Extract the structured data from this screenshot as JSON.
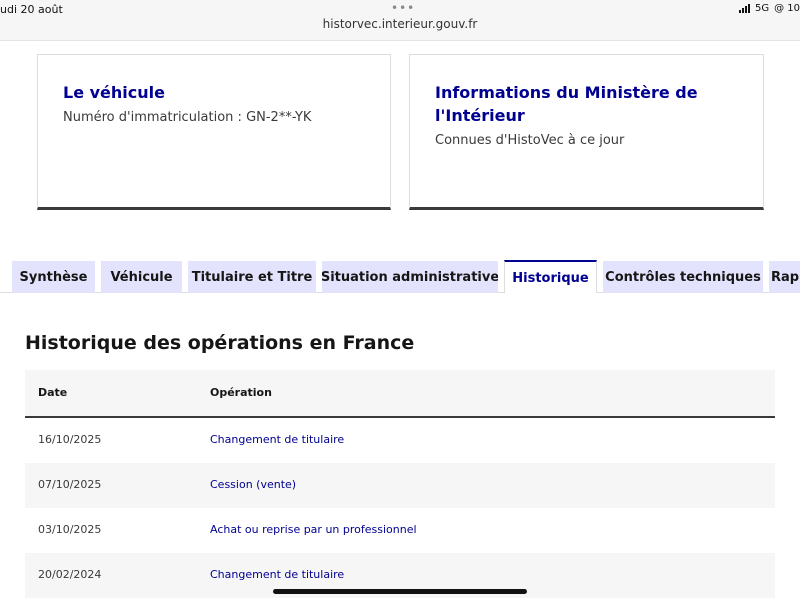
{
  "status_bar": {
    "date_text": "udi 20 août",
    "network": "5G",
    "battery_text": "@ 10"
  },
  "browser": {
    "url": "historvec.interieur.gouv.fr"
  },
  "cards": [
    {
      "title": "Le véhicule",
      "description": "Numéro d'immatriculation : GN-2**-YK"
    },
    {
      "title": "Informations du Ministère de l'Intérieur",
      "description": "Connues d'HistoVec à ce jour"
    }
  ],
  "tabs": [
    {
      "label": "Synthèse",
      "active": false
    },
    {
      "label": "Véhicule",
      "active": false
    },
    {
      "label": "Titulaire et Titre",
      "active": false
    },
    {
      "label": "Situation administrative",
      "active": false
    },
    {
      "label": "Historique",
      "active": true
    },
    {
      "label": "Contrôles techniques",
      "active": false
    },
    {
      "label": "Rap",
      "active": false
    }
  ],
  "history": {
    "title": "Historique des opérations en France",
    "columns": [
      "Date",
      "Opération"
    ],
    "rows": [
      {
        "date": "16/10/2025",
        "operation": "Changement de titulaire"
      },
      {
        "date": "07/10/2025",
        "operation": "Cession (vente)"
      },
      {
        "date": "03/10/2025",
        "operation": "Achat ou reprise par un professionnel"
      },
      {
        "date": "20/02/2024",
        "operation": "Changement de titulaire"
      }
    ]
  },
  "colors": {
    "accent": "#000091",
    "tab_bg": "#e3e3fd",
    "row_alt": "#f6f6f6"
  }
}
